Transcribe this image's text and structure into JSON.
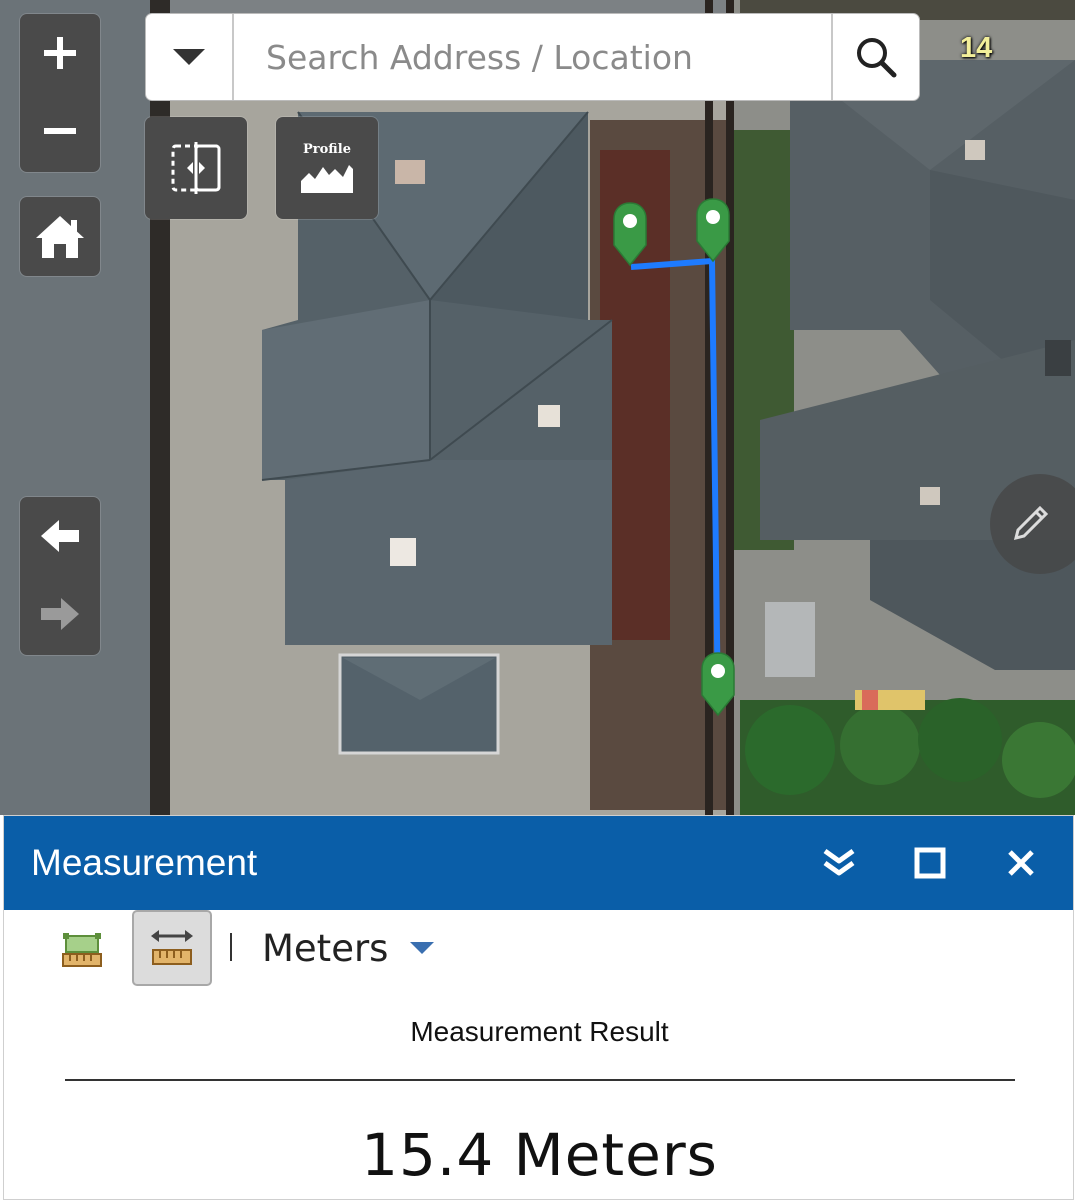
{
  "map": {
    "zoom_in_icon": "plus-icon",
    "zoom_out_icon": "minus-icon",
    "home_icon": "home-icon",
    "back_icon": "arrow-left-icon",
    "forward_icon": "arrow-right-icon",
    "zoom_level": "14",
    "search": {
      "placeholder": "Search Address / Location",
      "value": ""
    },
    "tools": {
      "swipe_icon": "swipe-icon",
      "profile_label": "Profile"
    },
    "colors": {
      "measure_line": "#1e7bff",
      "marker": "#3a9a46",
      "control_bg": "#4a4a4a"
    }
  },
  "panel": {
    "title": "Measurement",
    "colors": {
      "header": "#0a5ea8"
    },
    "unit": "Meters",
    "result_heading": "Measurement Result",
    "result_value": "15.4 Meters"
  }
}
